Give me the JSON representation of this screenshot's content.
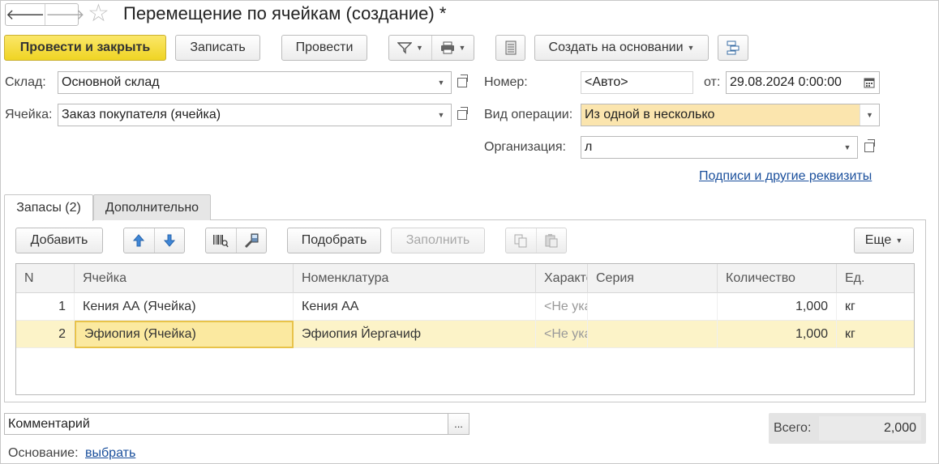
{
  "window": {
    "title": "Перемещение по ячейкам (создание) *",
    "nav_back": "🡐",
    "nav_forward": "🡒",
    "favorite_icon": "star-icon"
  },
  "toolbar": {
    "post_close": "Провести и закрыть",
    "save": "Записать",
    "post": "Провести",
    "create_based_on": "Создать на основании"
  },
  "header": {
    "warehouse_label": "Склад:",
    "warehouse_value": "Основной склад",
    "cell_label": "Ячейка:",
    "cell_value": "Заказ покупателя (ячейка)",
    "number_label": "Номер:",
    "number_placeholder": "<Авто>",
    "date_label": "от:",
    "date_value": "29.08.2024  0:00:00",
    "operation_label": "Вид операции:",
    "operation_value": "Из одной в несколько",
    "org_label": "Организация:",
    "org_value": "л",
    "signatures_link": "Подписи и другие реквизиты"
  },
  "tabs": [
    {
      "label": "Запасы (2)",
      "active": true
    },
    {
      "label": "Дополнительно",
      "active": false
    }
  ],
  "table_toolbar": {
    "add": "Добавить",
    "pick": "Подобрать",
    "fill": "Заполнить",
    "more": "Еще"
  },
  "table": {
    "columns": [
      "N",
      "Ячейка",
      "Номенклатура",
      "Характеристика",
      "Серия",
      "Количество",
      "Ед."
    ],
    "rows": [
      {
        "n": "1",
        "cell": "Кения АА (Ячейка)",
        "item": "Кения АА",
        "char": "<Не указана>",
        "series": "",
        "qty": "1,000",
        "unit": "кг"
      },
      {
        "n": "2",
        "cell": "Эфиопия (Ячейка)",
        "item": "Эфиопия Йергачиф",
        "char": "<Не указана>",
        "series": "",
        "qty": "1,000",
        "unit": "кг"
      }
    ]
  },
  "footer": {
    "comment_placeholder": "Комментарий",
    "comment_btn": "...",
    "total_label": "Всего:",
    "total_value": "2,000",
    "basis_label": "Основание:",
    "basis_link": "выбрать"
  }
}
